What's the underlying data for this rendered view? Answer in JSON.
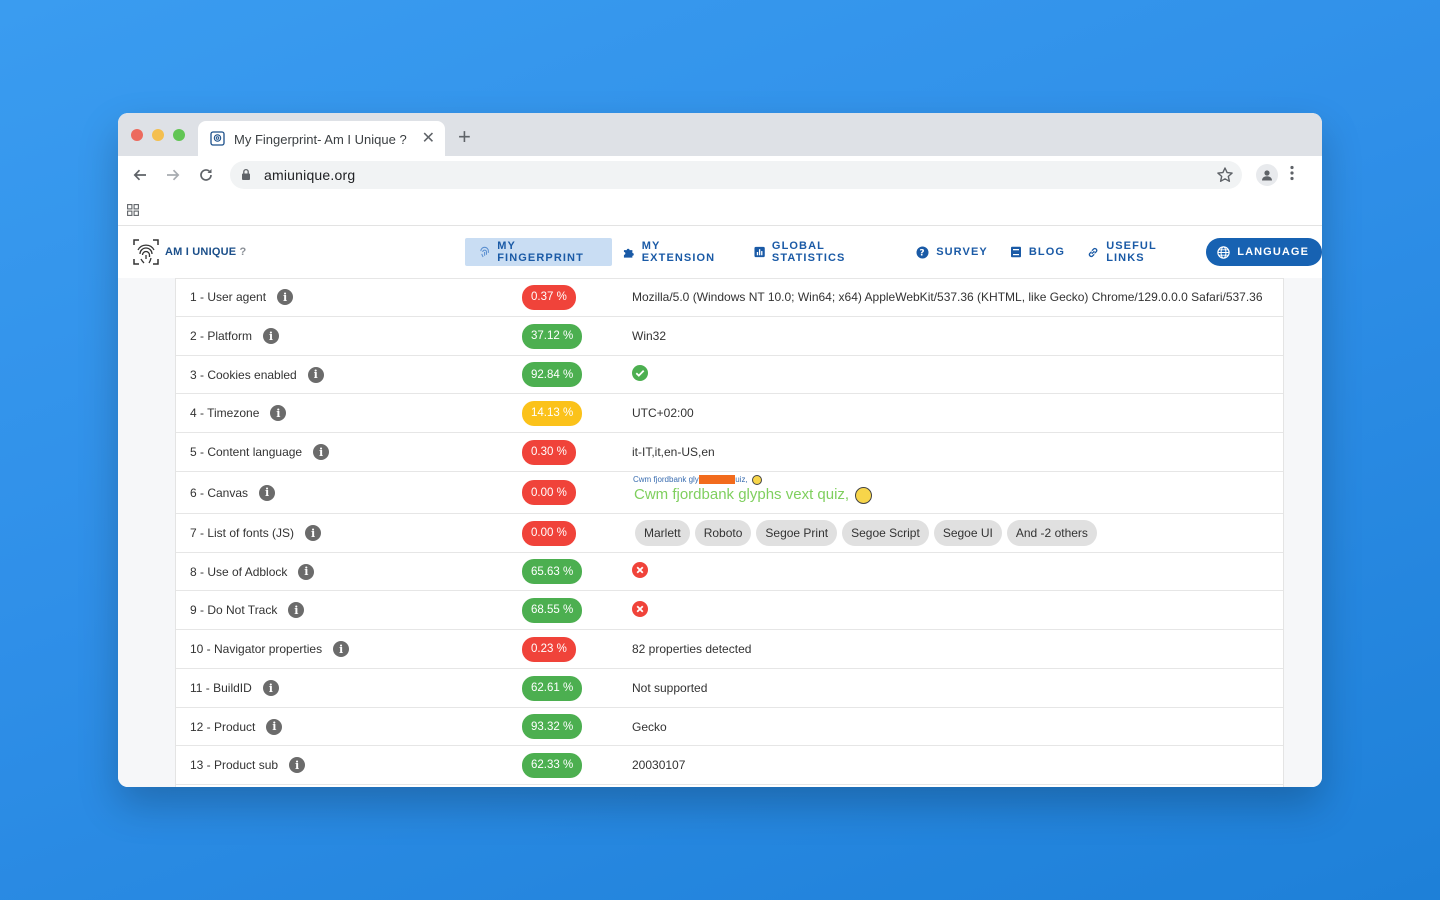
{
  "browser": {
    "tab_title": "My Fingerprint- Am I Unique ?",
    "url": "amiunique.org"
  },
  "site": {
    "logo_main": "AM I UNIQUE",
    "logo_suffix": " ?",
    "nav": [
      {
        "label": "MY FINGERPRINT",
        "icon": "fingerprint-icon",
        "active": true
      },
      {
        "label": "MY EXTENSION",
        "icon": "puzzle-icon"
      },
      {
        "label": "GLOBAL STATISTICS",
        "icon": "bar-chart-icon"
      },
      {
        "label": "SURVEY",
        "icon": "help-circle-icon"
      },
      {
        "label": "BLOG",
        "icon": "book-icon"
      },
      {
        "label": "USEFUL LINKS",
        "icon": "link-icon"
      },
      {
        "label": "LANGUAGE",
        "icon": "globe-icon"
      }
    ]
  },
  "rows": [
    {
      "label": "1 - User agent",
      "pct": "0.37 %",
      "level": "red",
      "value": "Mozilla/5.0 (Windows NT 10.0; Win64; x64) AppleWebKit/537.36 (KHTML, like Gecko) Chrome/129.0.0.0 Safari/537.36"
    },
    {
      "label": "2 - Platform",
      "pct": "37.12 %",
      "level": "green",
      "value": "Win32"
    },
    {
      "label": "3 - Cookies enabled",
      "pct": "92.84 %",
      "level": "green",
      "value": "check-circle-icon"
    },
    {
      "label": "4 - Timezone",
      "pct": "14.13 %",
      "level": "yellow",
      "value": "UTC+02:00"
    },
    {
      "label": "5 - Content language",
      "pct": "0.30 %",
      "level": "red",
      "value": "it-IT,it,en-US,en"
    },
    {
      "label": "6 - Canvas",
      "pct": "0.00 %",
      "level": "red",
      "value": "Cwm fjordbank glyphs vext quiz,"
    },
    {
      "label": "7 - List of fonts (JS)",
      "pct": "0.00 %",
      "level": "red",
      "value": ""
    },
    {
      "label": "8 - Use of Adblock",
      "pct": "65.63 %",
      "level": "green",
      "value": "cross-circle-icon"
    },
    {
      "label": "9 - Do Not Track",
      "pct": "68.55 %",
      "level": "green",
      "value": "cross-circle-icon"
    },
    {
      "label": "10 - Navigator properties",
      "pct": "0.23 %",
      "level": "red",
      "value": "82 properties detected"
    },
    {
      "label": "11 - BuildID",
      "pct": "62.61 %",
      "level": "green",
      "value": "Not supported"
    },
    {
      "label": "12 - Product",
      "pct": "93.32 %",
      "level": "green",
      "value": "Gecko"
    },
    {
      "label": "13 - Product sub",
      "pct": "62.33 %",
      "level": "green",
      "value": "20030107"
    }
  ],
  "fonts": [
    "Marlett",
    "Roboto",
    "Segoe Print",
    "Segoe Script",
    "Segoe UI",
    "And -2 others"
  ],
  "canvas": {
    "small_text_a": "Cwm fjordbank gly",
    "small_text_b": "phs vext q",
    "small_text_c": "uiz,",
    "big_text": "Cwm fjordbank glyphs vext quiz,"
  },
  "colors": {
    "red": "#f0433a",
    "green": "#4caf50",
    "yellow": "#fbc21a",
    "brand": "#1762b2"
  }
}
